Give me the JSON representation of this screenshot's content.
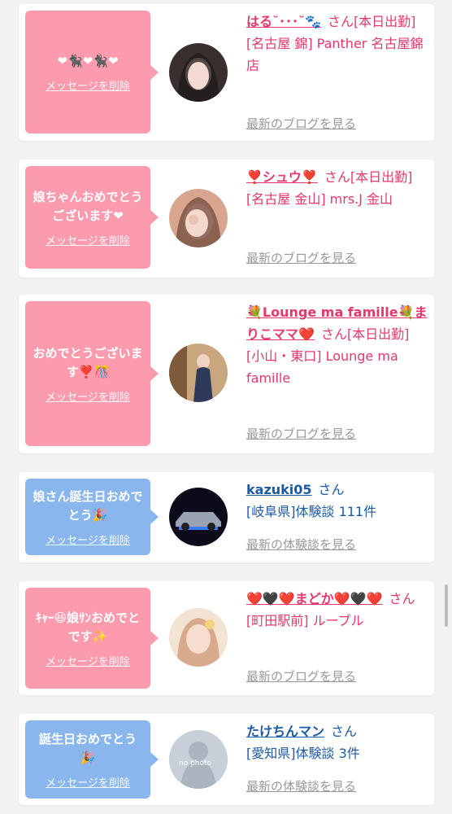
{
  "cards": [
    {
      "message": "❤🐈‍⬛❤🐈‍⬛❤",
      "delete_label": "メッセージを削除",
      "name": "はる˘･･･˘🐾",
      "san": "さん[本日出勤]",
      "shop": "[名古屋 錦] Panther 名古屋錦店",
      "link": "最新のブログを見る"
    },
    {
      "message": "娘ちゃんおめでとうございます❤",
      "delete_label": "メッセージを削除",
      "name": "❣️シュウ❣️",
      "san": "さん[本日出勤]",
      "shop": "[名古屋 金山] mrs.J 金山",
      "link": "最新のブログを見る"
    },
    {
      "message": "おめでとうございます❣️🎊",
      "delete_label": "メッセージを削除",
      "name": "💐Lounge ma famille💐まりこママ❤️",
      "san": "さん[本日出勤]",
      "shop": "[小山・東口] Lounge ma famille",
      "link": "最新のブログを見る"
    },
    {
      "message": "娘さん誕生日おめでとう🎉",
      "delete_label": "メッセージを削除",
      "name": "kazuki05",
      "san": "さん",
      "shop": "[岐阜県]体験談 111件",
      "link": "最新の体験談を見る"
    },
    {
      "message": "ｷｬｰ😆娘ｻﾝおめでとです✨",
      "delete_label": "メッセージを削除",
      "name": "❤️🖤❤️まどか❤️🖤❤️",
      "san": "さん",
      "shop": "[町田駅前] ルーブル",
      "link": "最新のブログを見る"
    },
    {
      "message": "誕生日おめでとう🎉",
      "delete_label": "メッセージを削除",
      "name": "たけちんマン",
      "san": "さん",
      "shop": "[愛知県]体験談 3件",
      "link": "最新の体験談を見る",
      "avatar_text": "no photo"
    }
  ]
}
